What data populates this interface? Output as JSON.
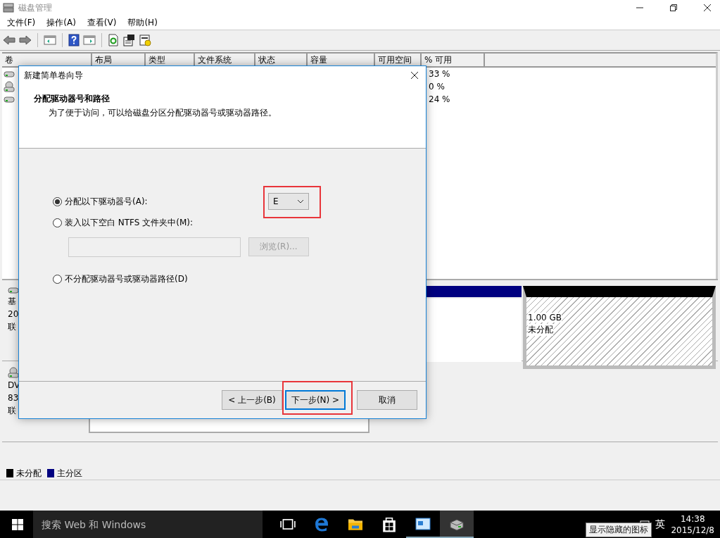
{
  "window": {
    "title": "磁盘管理"
  },
  "menu": [
    {
      "label": "文件(F)"
    },
    {
      "label": "操作(A)"
    },
    {
      "label": "查看(V)"
    },
    {
      "label": "帮助(H)"
    }
  ],
  "table": {
    "columns": [
      "卷",
      "布局",
      "类型",
      "文件系统",
      "状态",
      "容量",
      "可用空间",
      "% 可用"
    ],
    "rows": [
      {
        "kind": "disk",
        "percent_free": "33 %"
      },
      {
        "kind": "dvd",
        "percent_free": "0 %"
      },
      {
        "kind": "disk",
        "percent_free": "24 %"
      }
    ]
  },
  "disks": [
    {
      "kind": "disk",
      "lines": [
        "基",
        "20",
        "联"
      ]
    },
    {
      "kind": "dvd",
      "lines": [
        "DV",
        "83",
        "联"
      ]
    }
  ],
  "unallocated": {
    "size": "1.00 GB",
    "status": "未分配"
  },
  "legend": [
    {
      "label": "未分配",
      "color": "#000000"
    },
    {
      "label": "主分区",
      "color": "#000080"
    }
  ],
  "dialog": {
    "title": "新建简单卷向导",
    "heading": "分配驱动器号和路径",
    "subheading": "为了便于访问，可以给磁盘分区分配驱动器号或驱动器路径。",
    "options": [
      {
        "label": "分配以下驱动器号(A):",
        "selected": true
      },
      {
        "label": "装入以下空白 NTFS 文件夹中(M):",
        "selected": false
      },
      {
        "label": "不分配驱动器号或驱动器路径(D)",
        "selected": false
      }
    ],
    "drive_letter": "E",
    "browse": {
      "label": "浏览(R)...",
      "disabled": true
    },
    "buttons": {
      "back": "< 上一步(B)",
      "next": "下一步(N) >",
      "cancel": "取消"
    }
  },
  "taskbar": {
    "search_placeholder": "搜索 Web 和 Windows",
    "ime": "英",
    "time": "14:38",
    "date": "2015/12/8",
    "tooltip": "显示隐藏的图标"
  }
}
